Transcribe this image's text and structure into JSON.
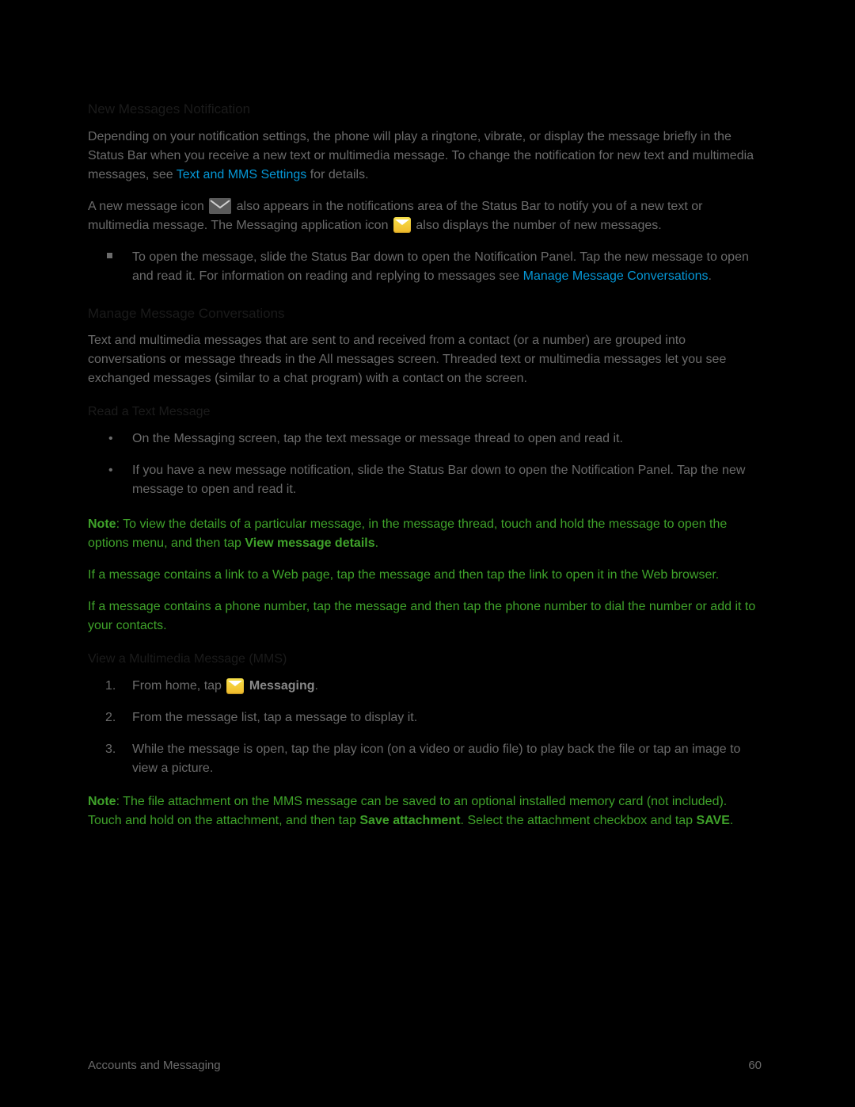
{
  "heading1": "New Messages Notification",
  "para1_a": "Depending on your notification settings, the phone will play a ringtone, vibrate, or display the message briefly in the Status Bar when you receive a new text or multimedia message. To change the notification for new text and multimedia messages, see ",
  "link1": "Text and MMS Settings",
  "para1_b": " for details.",
  "para2_a": "A new message icon ",
  "para2_b": " also appears in the notifications area of the Status Bar to notify you of a new text or multimedia message. The Messaging application icon ",
  "para2_c": " also displays the number of new messages.",
  "bullet_sq_1a": "To open the message, slide the Status Bar down to open the Notification Panel. Tap the new message to open and read it. For information on reading and replying to messages see ",
  "bullet_sq_1_link": "Manage Message Conversations",
  "bullet_sq_1b": ".",
  "heading2": "Manage Message Conversations",
  "para3": "Text and multimedia messages that are sent to and received from a contact (or a number) are grouped into conversations or message threads in the All messages screen. Threaded text or multimedia messages let you see exchanged messages (similar to a chat program) with a contact on the screen.",
  "subheading1": "Read a Text Message",
  "bullet_round_1": "On the Messaging screen, tap the text message or message thread to open and read it.",
  "bullet_round_2": "If you have a new message notification, slide the Status Bar down to open the Notification Panel. Tap the new message to open and read it.",
  "note1_label": "Note",
  "note1_a": ": To view the details of a particular message, in the message thread, touch and hold the message to open the options menu, and then tap ",
  "note1_bold": "View message details",
  "note1_b": ".",
  "note2": "If a message contains a link to a Web page, tap the message and then tap the link to open it in the Web browser.",
  "note3": "If a message contains a phone number, tap the message and then tap the phone number to dial the number or add it to your contacts.",
  "subheading2": "View a Multimedia Message (MMS)",
  "step1_a": "From home, tap ",
  "step1_bold": " Messaging",
  "step1_b": ".",
  "step2": "From the message list, tap a message to display it.",
  "step3": "While the message is open, tap the play icon (on a video or audio file) to play back the file or tap an image to view a picture.",
  "note4_label": "Note",
  "note4_a": ": The file attachment on the MMS message can be saved to an optional installed memory card (not included). Touch and hold on the attachment, and then tap ",
  "note4_bold1": "Save attachment",
  "note4_b": ". Select the attachment checkbox and tap ",
  "note4_bold2": "SAVE",
  "note4_c": ".",
  "footer_left": "Accounts and Messaging",
  "footer_right": "60"
}
